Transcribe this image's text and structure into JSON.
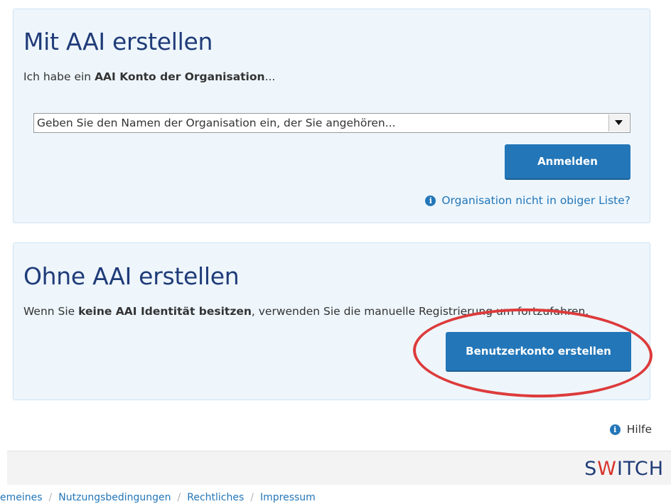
{
  "aai_section": {
    "title": "Mit AAI erstellen",
    "text_prefix": "Ich habe ein ",
    "text_bold": "AAI Konto der Organisation",
    "text_suffix": "...",
    "select_placeholder": "Geben Sie den Namen der Organisation ein, der Sie angehören...",
    "login_button": "Anmelden",
    "org_not_listed_link": "Organisation nicht in obiger Liste?"
  },
  "no_aai_section": {
    "title": "Ohne AAI erstellen",
    "text_prefix": "Wenn Sie ",
    "text_bold": "keine AAI Identität besitzen",
    "text_suffix": ", verwenden Sie die manuelle Registrierung um fortzufahren.",
    "create_account_button": "Benutzerkonto erstellen"
  },
  "help_link": "Hilfe",
  "footer": {
    "logo_left": "S",
    "logo_accent": "W",
    "logo_right": "ITCH",
    "links": [
      "emeines",
      "Nutzungsbedingungen",
      "Rechtliches",
      "Impressum"
    ],
    "separator": "/"
  },
  "colors": {
    "accent": "#2376b8",
    "title": "#1f3b78",
    "highlight_ellipse": "#dd3b3b",
    "panel_bg": "#eef6fc"
  }
}
